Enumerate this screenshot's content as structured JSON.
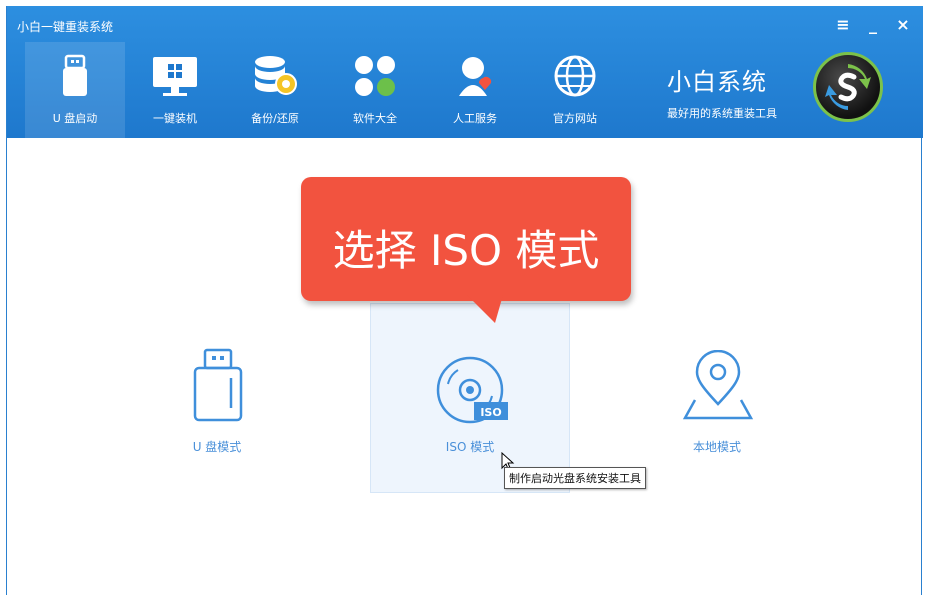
{
  "window": {
    "title": "小白一键重装系统"
  },
  "controls": {
    "menu": "≡",
    "minimize": "_",
    "close": "×"
  },
  "nav": [
    {
      "label": "U 盘启动",
      "icon": "usb-drive-icon",
      "active": true
    },
    {
      "label": "一键装机",
      "icon": "monitor-windows-icon",
      "active": false
    },
    {
      "label": "备份/还原",
      "icon": "database-backup-icon",
      "active": false
    },
    {
      "label": "软件大全",
      "icon": "software-grid-icon",
      "active": false
    },
    {
      "label": "人工服务",
      "icon": "support-person-icon",
      "active": false
    },
    {
      "label": "官方网站",
      "icon": "globe-icon",
      "active": false
    }
  ],
  "brand": {
    "title": "小白系统",
    "subtitle": "最好用的系统重装工具"
  },
  "modes": [
    {
      "label": "U 盘模式",
      "icon": "usb-drive-icon"
    },
    {
      "label": "ISO 模式",
      "icon": "iso-disc-icon"
    },
    {
      "label": "本地模式",
      "icon": "location-pin-icon"
    }
  ],
  "callout": {
    "text": "选择 ISO 模式"
  },
  "iso_badge": "ISO",
  "tooltip": {
    "text": "制作启动光盘系统安装工具"
  },
  "colors": {
    "header": "#1e78cd",
    "accent": "#3f8fdb",
    "callout": "#f2533f"
  }
}
